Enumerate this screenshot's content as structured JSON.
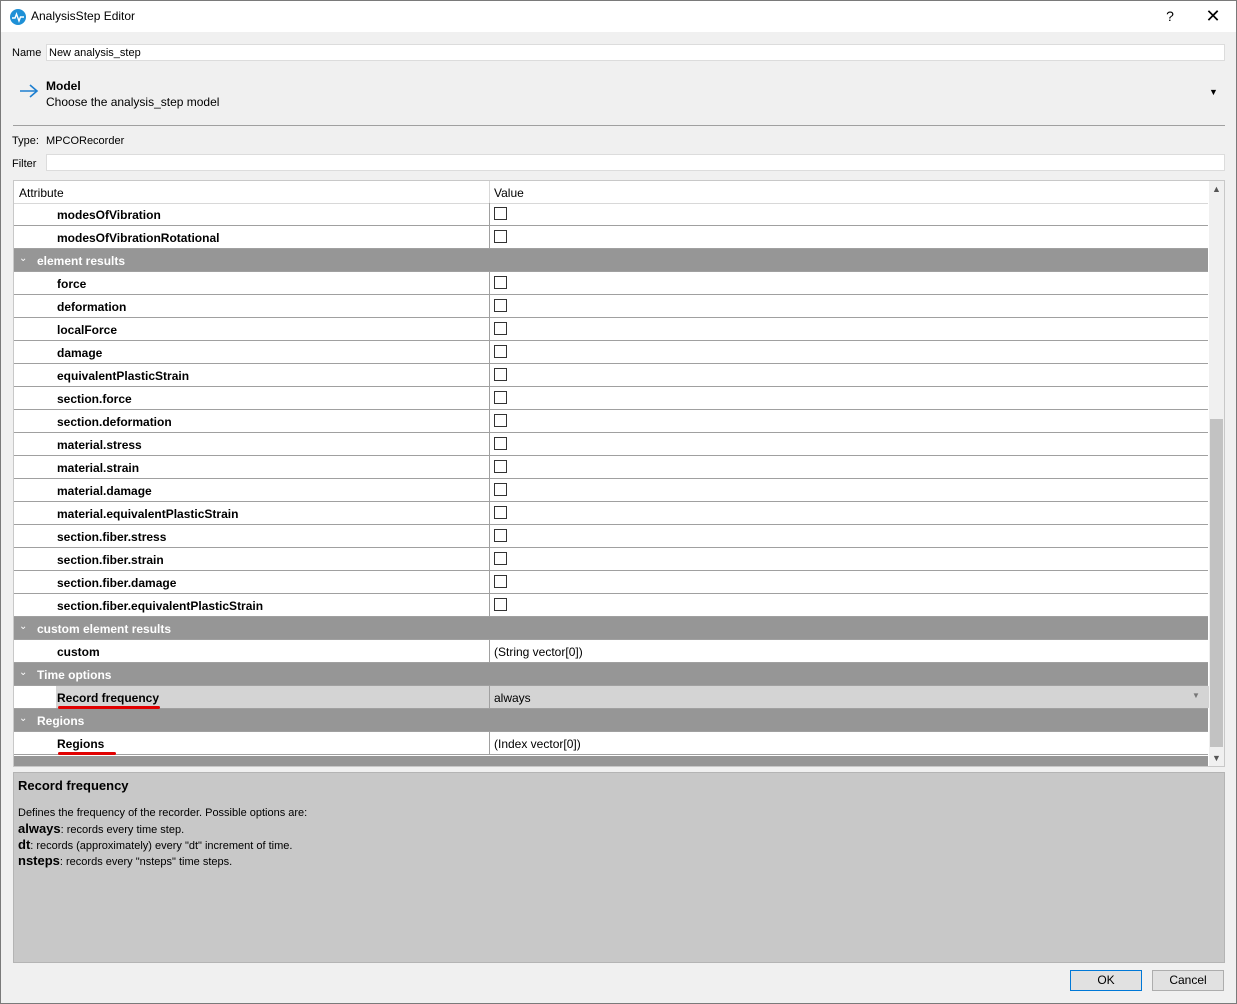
{
  "window": {
    "title": "AnalysisStep Editor",
    "help_label": "?",
    "close_label": "✕"
  },
  "name": {
    "label": "Name",
    "value": "New analysis_step"
  },
  "model": {
    "title": "Model",
    "subtitle": "Choose the analysis_step model"
  },
  "type": {
    "label": "Type:",
    "value": "MPCORecorder"
  },
  "filter": {
    "label": "Filter",
    "value": ""
  },
  "table": {
    "headers": {
      "attribute": "Attribute",
      "value": "Value"
    },
    "rows": [
      {
        "kind": "item",
        "name": "modesOfVibration",
        "value_type": "checkbox"
      },
      {
        "kind": "item",
        "name": "modesOfVibrationRotational",
        "value_type": "checkbox"
      },
      {
        "kind": "group",
        "name": "element results"
      },
      {
        "kind": "item",
        "name": "force",
        "value_type": "checkbox"
      },
      {
        "kind": "item",
        "name": "deformation",
        "value_type": "checkbox"
      },
      {
        "kind": "item",
        "name": "localForce",
        "value_type": "checkbox"
      },
      {
        "kind": "item",
        "name": "damage",
        "value_type": "checkbox"
      },
      {
        "kind": "item",
        "name": "equivalentPlasticStrain",
        "value_type": "checkbox"
      },
      {
        "kind": "item",
        "name": "section.force",
        "value_type": "checkbox"
      },
      {
        "kind": "item",
        "name": "section.deformation",
        "value_type": "checkbox"
      },
      {
        "kind": "item",
        "name": "material.stress",
        "value_type": "checkbox"
      },
      {
        "kind": "item",
        "name": "material.strain",
        "value_type": "checkbox"
      },
      {
        "kind": "item",
        "name": "material.damage",
        "value_type": "checkbox"
      },
      {
        "kind": "item",
        "name": "material.equivalentPlasticStrain",
        "value_type": "checkbox"
      },
      {
        "kind": "item",
        "name": "section.fiber.stress",
        "value_type": "checkbox"
      },
      {
        "kind": "item",
        "name": "section.fiber.strain",
        "value_type": "checkbox"
      },
      {
        "kind": "item",
        "name": "section.fiber.damage",
        "value_type": "checkbox"
      },
      {
        "kind": "item",
        "name": "section.fiber.equivalentPlasticStrain",
        "value_type": "checkbox"
      },
      {
        "kind": "group",
        "name": "custom element results"
      },
      {
        "kind": "item",
        "name": "custom",
        "value_type": "text",
        "value": "(String vector[0])"
      },
      {
        "kind": "group",
        "name": "Time options"
      },
      {
        "kind": "item",
        "name": "Record frequency",
        "value_type": "combo",
        "value": "always",
        "selected": true
      },
      {
        "kind": "group",
        "name": "Regions"
      },
      {
        "kind": "item",
        "name": "Regions",
        "value_type": "text",
        "value": "(Index vector[0])"
      }
    ]
  },
  "description": {
    "title": "Record frequency",
    "intro": "Defines the frequency of the recorder. Possible options are:",
    "options": [
      {
        "key": "always",
        "text": ": records every time step."
      },
      {
        "key": "dt",
        "text": ": records (approximately) every \"dt\" increment of time."
      },
      {
        "key": "nsteps",
        "text": ": records every \"nsteps\" time steps."
      }
    ]
  },
  "buttons": {
    "ok": "OK",
    "cancel": "Cancel"
  },
  "colors": {
    "group_bg": "#969696",
    "accent": "#0078d7",
    "annotation": "#e00000"
  }
}
